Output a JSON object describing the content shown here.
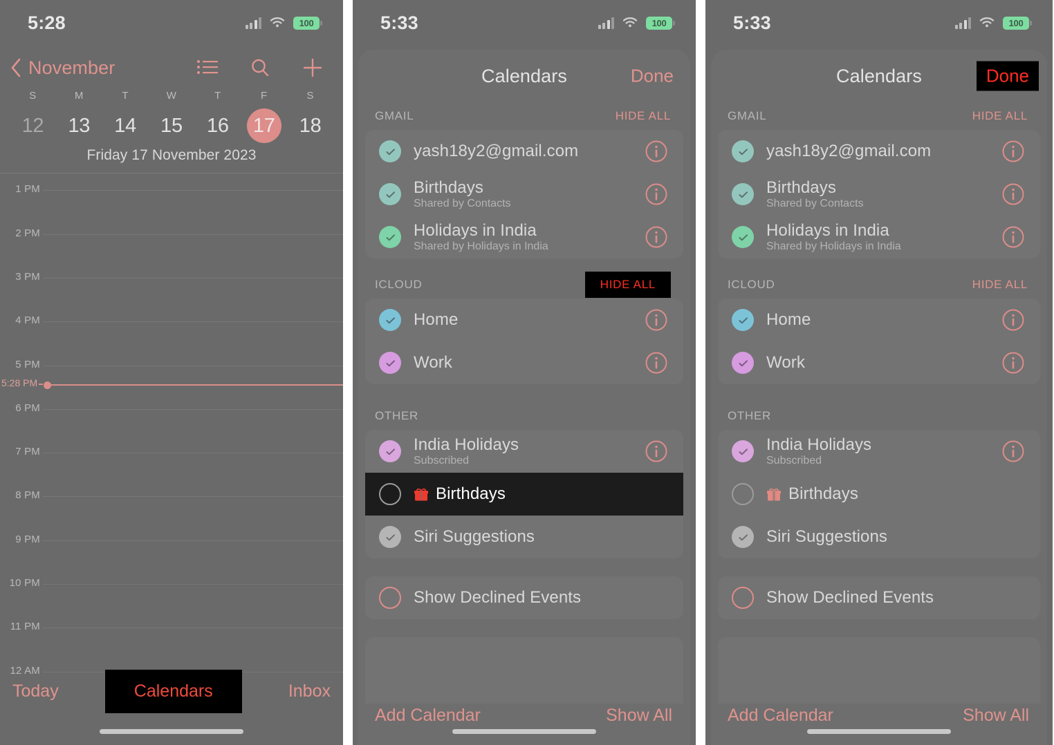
{
  "panel1": {
    "status": {
      "time": "5:28",
      "battery": "100",
      "signal_icon": "cellular-signal-icon",
      "wifi_icon": "wifi-icon",
      "battery_icon": "battery-icon"
    },
    "nav": {
      "back_label": "November",
      "back_icon": "chevron-left-icon",
      "list_icon": "list-view-icon",
      "search_icon": "search-icon",
      "add_icon": "plus-icon"
    },
    "weekdays": [
      "S",
      "M",
      "T",
      "W",
      "T",
      "F",
      "S"
    ],
    "dates": [
      {
        "num": "12",
        "state": "dim"
      },
      {
        "num": "13",
        "state": "normal"
      },
      {
        "num": "14",
        "state": "normal"
      },
      {
        "num": "15",
        "state": "normal"
      },
      {
        "num": "16",
        "state": "normal"
      },
      {
        "num": "17",
        "state": "selected"
      },
      {
        "num": "18",
        "state": "normal"
      }
    ],
    "full_date": "Friday  17 November 2023",
    "hours": [
      "1 PM",
      "2 PM",
      "3 PM",
      "4 PM",
      "5 PM",
      "6 PM",
      "7 PM",
      "8 PM",
      "9 PM",
      "10 PM",
      "11 PM",
      "12 AM"
    ],
    "now_indicator": {
      "label": "5:28 PM",
      "color": "#dc8e8b"
    },
    "tabs": {
      "today": "Today",
      "calendars": "Calendars",
      "inbox": "Inbox",
      "highlighted": "Calendars"
    }
  },
  "panel2": {
    "status": {
      "time": "5:33",
      "battery": "100"
    },
    "sheet": {
      "title": "Calendars",
      "done_label": "Done",
      "done_highlighted": false
    },
    "sections": [
      {
        "title": "GMAIL",
        "hide_all": "HIDE ALL",
        "hide_all_highlighted": false,
        "rows": [
          {
            "name": "yash18y2@gmail.com",
            "sub": "",
            "checked": true,
            "color": "#93c7bd",
            "info": true,
            "highlighted": false
          },
          {
            "name": "Birthdays",
            "sub": "Shared by Contacts",
            "checked": true,
            "color": "#93c7bd",
            "info": true,
            "highlighted": false
          },
          {
            "name": "Holidays in India",
            "sub": "Shared by Holidays in India",
            "checked": true,
            "color": "#7fd3a8",
            "info": true,
            "highlighted": false
          }
        ]
      },
      {
        "title": "ICLOUD",
        "hide_all": "HIDE ALL",
        "hide_all_highlighted": true,
        "rows": [
          {
            "name": "Home",
            "sub": "",
            "checked": true,
            "color": "#7cc3d8",
            "info": true,
            "highlighted": false
          },
          {
            "name": "Work",
            "sub": "",
            "checked": true,
            "color": "#d79be0",
            "info": true,
            "highlighted": false
          }
        ]
      },
      {
        "title": "OTHER",
        "hide_all": "",
        "hide_all_highlighted": false,
        "rows": [
          {
            "name": "India Holidays",
            "sub": "Subscribed",
            "checked": true,
            "color": "#d9a6de",
            "info": true,
            "highlighted": false
          },
          {
            "name": "Birthdays",
            "sub": "",
            "checked": false,
            "color": "",
            "info": false,
            "highlighted": true,
            "gift_icon": "gift-icon"
          },
          {
            "name": "Siri Suggestions",
            "sub": "",
            "checked": true,
            "color": "#b5b5b5",
            "info": false,
            "highlighted": false
          }
        ]
      }
    ],
    "declined": {
      "label": "Show Declined Events",
      "checked": false
    },
    "footer": {
      "add_calendar": "Add Calendar",
      "show_all": "Show All"
    }
  },
  "panel3": {
    "status": {
      "time": "5:33",
      "battery": "100"
    },
    "sheet": {
      "title": "Calendars",
      "done_label": "Done",
      "done_highlighted": true
    },
    "sections": [
      {
        "title": "GMAIL",
        "hide_all": "HIDE ALL",
        "hide_all_highlighted": false,
        "rows": [
          {
            "name": "yash18y2@gmail.com",
            "sub": "",
            "checked": true,
            "color": "#93c7bd",
            "info": true,
            "highlighted": false
          },
          {
            "name": "Birthdays",
            "sub": "Shared by Contacts",
            "checked": true,
            "color": "#93c7bd",
            "info": true,
            "highlighted": false
          },
          {
            "name": "Holidays in India",
            "sub": "Shared by Holidays in India",
            "checked": true,
            "color": "#7fd3a8",
            "info": true,
            "highlighted": false
          }
        ]
      },
      {
        "title": "ICLOUD",
        "hide_all": "HIDE ALL",
        "hide_all_highlighted": false,
        "rows": [
          {
            "name": "Home",
            "sub": "",
            "checked": true,
            "color": "#7cc3d8",
            "info": true,
            "highlighted": false
          },
          {
            "name": "Work",
            "sub": "",
            "checked": true,
            "color": "#d79be0",
            "info": true,
            "highlighted": false
          }
        ]
      },
      {
        "title": "OTHER",
        "hide_all": "",
        "hide_all_highlighted": false,
        "rows": [
          {
            "name": "India Holidays",
            "sub": "Subscribed",
            "checked": true,
            "color": "#d9a6de",
            "info": true,
            "highlighted": false
          },
          {
            "name": "Birthdays",
            "sub": "",
            "checked": false,
            "color": "",
            "info": false,
            "highlighted": false,
            "gift_icon": "gift-icon"
          },
          {
            "name": "Siri Suggestions",
            "sub": "",
            "checked": true,
            "color": "#b5b5b5",
            "info": false,
            "highlighted": false
          }
        ]
      }
    ],
    "declined": {
      "label": "Show Declined Events",
      "checked": false
    },
    "footer": {
      "add_calendar": "Add Calendar",
      "show_all": "Show All"
    }
  },
  "colors": {
    "accent_red": "#e0938e",
    "highlight_bg": "#000000",
    "highlight_text": "#ff2d20",
    "background": "#6a6a6a",
    "sheet_bg": "#6e6e6e"
  }
}
